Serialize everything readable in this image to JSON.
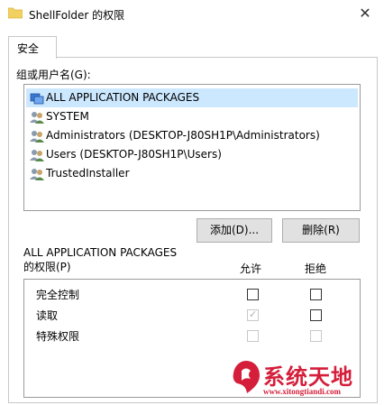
{
  "window": {
    "title": "ShellFolder 的权限",
    "close_glyph": "✕",
    "folder_icon": "folder-icon",
    "folder_color": "#f3d160"
  },
  "tabs": [
    {
      "label": "安全",
      "selected": true
    }
  ],
  "users_group": {
    "label": "组或用户名(G):",
    "items": [
      {
        "label": "ALL APPLICATION PACKAGES",
        "icon": "app-packages-icon",
        "selected": true
      },
      {
        "label": "SYSTEM",
        "icon": "user-group-icon",
        "selected": false
      },
      {
        "label": "Administrators (DESKTOP-J80SH1P\\Administrators)",
        "icon": "user-group-icon",
        "selected": false
      },
      {
        "label": "Users (DESKTOP-J80SH1P\\Users)",
        "icon": "user-group-icon",
        "selected": false
      },
      {
        "label": "TrustedInstaller",
        "icon": "user-group-icon",
        "selected": false
      }
    ]
  },
  "buttons": {
    "add": "添加(D)...",
    "remove": "删除(R)"
  },
  "permissions": {
    "header_line1": "ALL APPLICATION PACKAGES",
    "header_line2": "的权限(P)",
    "col_allow": "允许",
    "col_deny": "拒绝",
    "rows": [
      {
        "name": "完全控制",
        "allow": false,
        "deny": false,
        "allow_disabled": false,
        "deny_disabled": false
      },
      {
        "name": "读取",
        "allow": true,
        "deny": false,
        "allow_disabled": true,
        "deny_disabled": false
      },
      {
        "name": "特殊权限",
        "allow": false,
        "deny": false,
        "allow_disabled": true,
        "deny_disabled": true
      }
    ]
  },
  "watermark": {
    "text": "系统天地",
    "url": "www.xitongtiandi.com",
    "color": "#d41e3a"
  },
  "colors": {
    "selection": "#cce8ff",
    "button_bg": "#e1e1e1",
    "border": "#9a9a9a"
  }
}
